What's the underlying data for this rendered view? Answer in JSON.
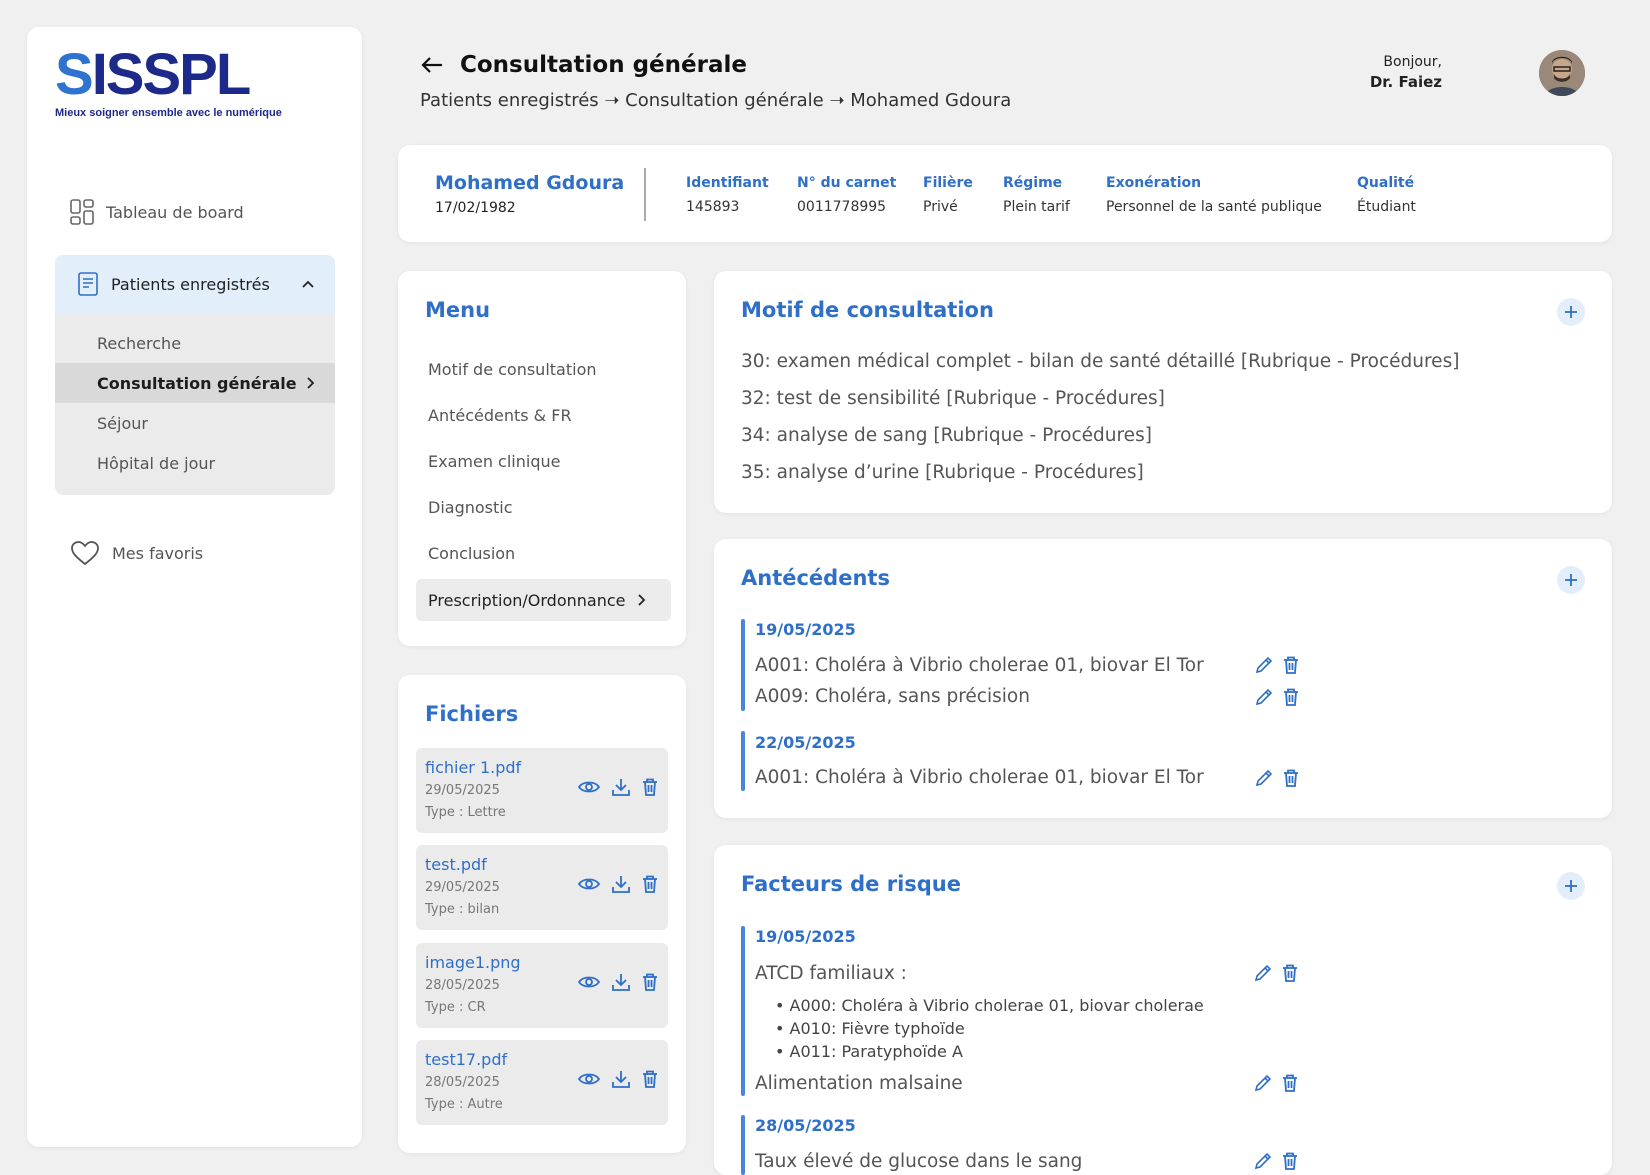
{
  "brand": {
    "logo_text_a": "S",
    "logo_text_b": "ISSPL",
    "tagline": "Mieux soigner ensemble avec le numérique"
  },
  "sidebar": {
    "dashboard": "Tableau de board",
    "patients": "Patients enregistrés",
    "sub_items": [
      "Recherche",
      "Consultation générale",
      "Séjour",
      "Hôpital de jour"
    ],
    "favorites": "Mes favoris"
  },
  "header": {
    "title": "Consultation générale",
    "breadcrumb": "Patients enregistrés ➝ Consultation générale ➝ Mohamed Gdoura",
    "greeting": "Bonjour,",
    "user": "Dr. Faiez"
  },
  "patient": {
    "name": "Mohamed Gdoura",
    "dob": "17/02/1982",
    "fields": [
      {
        "label": "Identifiant",
        "value": "145893"
      },
      {
        "label": "N° du carnet",
        "value": "0011778995"
      },
      {
        "label": "Filière",
        "value": "Privé"
      },
      {
        "label": "Régime",
        "value": "Plein tarif"
      },
      {
        "label": "Exonération",
        "value": "Personnel de la santé publique"
      },
      {
        "label": "Qualité",
        "value": "Étudiant"
      }
    ]
  },
  "menu": {
    "title": "Menu",
    "items": [
      "Motif de consultation",
      "Antécédents & FR",
      "Examen clinique",
      "Diagnostic",
      "Conclusion"
    ],
    "active": "Prescription/Ordonnance"
  },
  "files": {
    "title": "Fichiers",
    "items": [
      {
        "name": "fichier 1.pdf",
        "date": "29/05/2025",
        "type": "Type : Lettre"
      },
      {
        "name": "test.pdf",
        "date": "29/05/2025",
        "type": "Type : bilan"
      },
      {
        "name": "image1.png",
        "date": "28/05/2025",
        "type": "Type : CR"
      },
      {
        "name": "test17.pdf",
        "date": "28/05/2025",
        "type": "Type : Autre"
      }
    ]
  },
  "motif": {
    "title": "Motif de consultation",
    "lines": [
      "30: examen médical complet - bilan de santé détaillé [Rubrique - Procédures]",
      "32: test de sensibilité [Rubrique - Procédures]",
      "34: analyse de sang [Rubrique - Procédures]",
      "35: analyse d’urine [Rubrique - Procédures]"
    ]
  },
  "antecedents": {
    "title": "Antécédents",
    "groups": [
      {
        "date": "19/05/2025",
        "entries": [
          "A001: Choléra à Vibrio cholerae 01, biovar El Tor",
          "A009: Choléra, sans précision"
        ]
      },
      {
        "date": "22/05/2025",
        "entries": [
          "A001: Choléra à Vibrio cholerae 01, biovar El Tor"
        ]
      }
    ]
  },
  "risk": {
    "title": "Facteurs de risque",
    "g1_date": "19/05/2025",
    "g1_entry1": "ATCD familiaux :",
    "g1_bullets": [
      "A000: Choléra à Vibrio cholerae 01, biovar cholerae",
      "A010: Fièvre typhoïde",
      "A011: Paratyphoïde A"
    ],
    "g1_entry2": "Alimentation malsaine",
    "g2_date": "28/05/2025",
    "g2_entry1": "Taux élevé de glucose dans le sang"
  },
  "colors": {
    "accent": "#2f6fc8",
    "navy": "#1e2a8a",
    "active_bg": "#e3eefb"
  },
  "icons": [
    "arrow-left-icon",
    "dashboard-icon",
    "document-list-icon",
    "chevron-up-icon",
    "chevron-right-icon",
    "heart-icon",
    "plus-icon",
    "eye-icon",
    "download-icon",
    "trash-icon",
    "edit-icon"
  ]
}
